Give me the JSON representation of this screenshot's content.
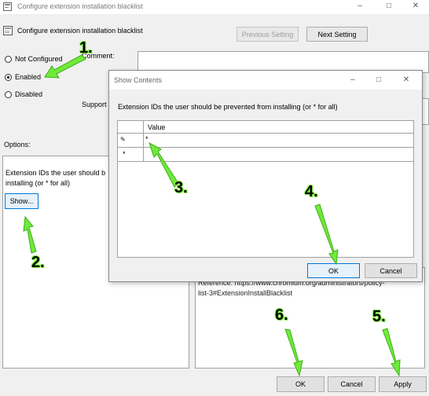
{
  "window": {
    "title": "Configure extension installation blacklist",
    "header_title": "Configure extension installation blacklist",
    "prev_setting": "Previous Setting",
    "next_setting": "Next Setting"
  },
  "radios": [
    {
      "label": "Not Configured",
      "selected": false
    },
    {
      "label": "Enabled",
      "selected": true
    },
    {
      "label": "Disabled",
      "selected": false
    }
  ],
  "labels": {
    "comment": "Comment:",
    "supported": "Support",
    "options": "Options:"
  },
  "options_panel": {
    "text_line1": "Extension IDs the user should b",
    "text_line2": "installing (or * for all)",
    "show_button": "Show..."
  },
  "help_panel": {
    "line1": "Reference: https://www.chromium.org/administrators/policy-",
    "line2": "list-3#ExtensionInstallBlacklist"
  },
  "bottom_buttons": {
    "ok": "OK",
    "cancel": "Cancel",
    "apply": "Apply"
  },
  "dialog": {
    "title": "Show Contents",
    "description": "Extension IDs the user should be prevented from installing (or * for all)",
    "column_header": "Value",
    "rows": [
      {
        "marker": "✎",
        "value": "*"
      },
      {
        "marker": "*",
        "value": ""
      }
    ],
    "ok": "OK",
    "cancel": "Cancel"
  },
  "annotations": [
    "1.",
    "2.",
    "3.",
    "4.",
    "5.",
    "6."
  ],
  "colors": {
    "arrow": "#6fea3a",
    "arrow_outline": "#3fae18"
  }
}
